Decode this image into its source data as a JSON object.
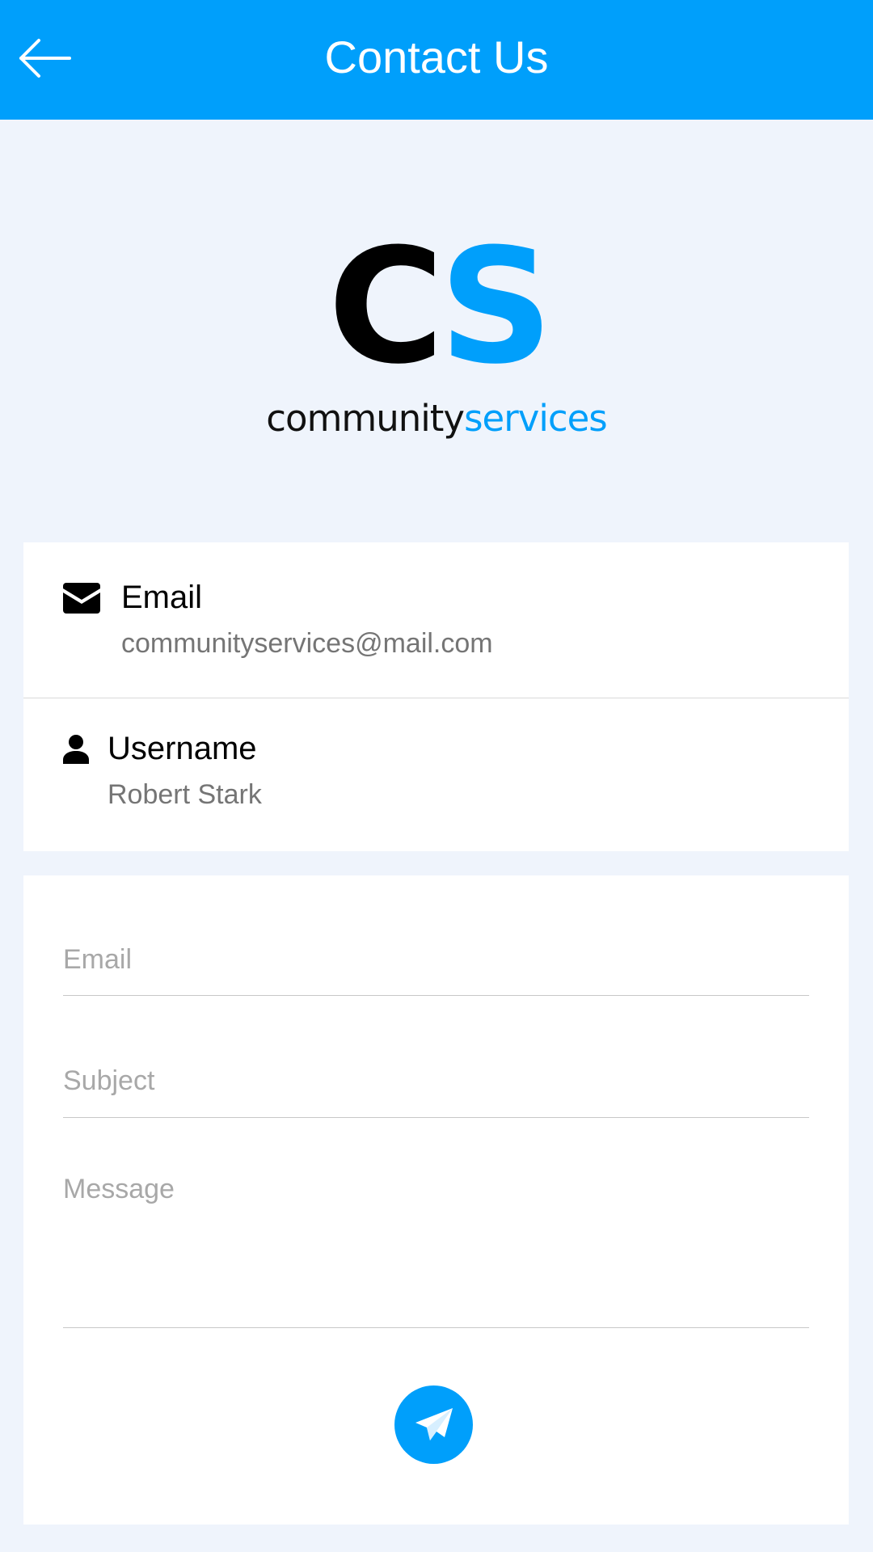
{
  "appbar": {
    "title": "Contact Us",
    "back_icon": "arrow-left-icon",
    "background": "#009ffb"
  },
  "logo": {
    "mark_c": "C",
    "mark_s": "S",
    "word_1": "community",
    "word_2": "services",
    "accent_color": "#009ffb"
  },
  "contact_info": {
    "email": {
      "icon": "envelope-icon",
      "label": "Email",
      "value": "communityservices@mail.com"
    },
    "username": {
      "icon": "person-icon",
      "label": "Username",
      "value": "Robert Stark"
    }
  },
  "form": {
    "email_placeholder": "Email",
    "subject_placeholder": "Subject",
    "message_placeholder": "Message",
    "send_icon": "paper-plane-icon"
  }
}
